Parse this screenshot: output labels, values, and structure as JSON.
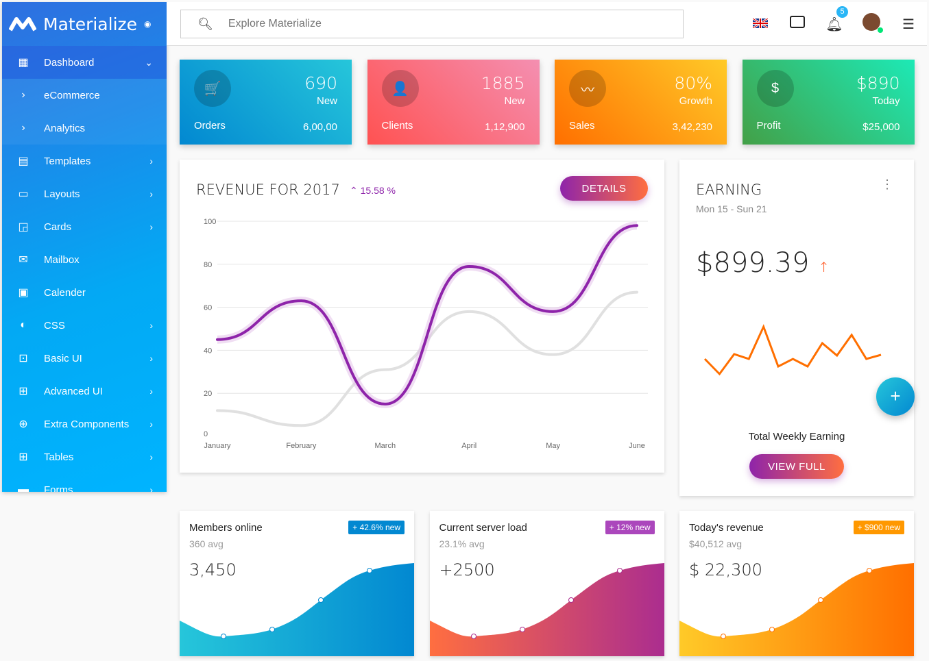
{
  "brand": {
    "name": "Materialize"
  },
  "sidebar": {
    "items": [
      {
        "label": "Dashboard",
        "icon": "dashboard-icon",
        "glyph": "▦",
        "chev": "⌄"
      },
      {
        "label": "eCommerce",
        "icon": "chevron-right-icon",
        "glyph": "›",
        "chev": ""
      },
      {
        "label": "Analytics",
        "icon": "chevron-right-icon",
        "glyph": "›",
        "chev": ""
      },
      {
        "label": "Templates",
        "icon": "templates-icon",
        "glyph": "▤",
        "chev": "›"
      },
      {
        "label": "Layouts",
        "icon": "layouts-icon",
        "glyph": "▭",
        "chev": "›"
      },
      {
        "label": "Cards",
        "icon": "cards-icon",
        "glyph": "◲",
        "chev": "›"
      },
      {
        "label": "Mailbox",
        "icon": "mail-icon",
        "glyph": "✉",
        "chev": ""
      },
      {
        "label": "Calender",
        "icon": "calendar-icon",
        "glyph": "▣",
        "chev": ""
      },
      {
        "label": "CSS",
        "icon": "drop-icon",
        "glyph": "◐",
        "chev": "›"
      },
      {
        "label": "Basic UI",
        "icon": "basic-ui-icon",
        "glyph": "⊡",
        "chev": "›"
      },
      {
        "label": "Advanced UI",
        "icon": "advanced-ui-icon",
        "glyph": "⊞",
        "chev": "›"
      },
      {
        "label": "Extra Components",
        "icon": "extra-icon",
        "glyph": "⊕",
        "chev": "›"
      },
      {
        "label": "Tables",
        "icon": "tables-icon",
        "glyph": "⊞",
        "chev": "›"
      },
      {
        "label": "Forms",
        "icon": "forms-icon",
        "glyph": "▬",
        "chev": "›"
      }
    ]
  },
  "header": {
    "search_placeholder": "Explore Materialize",
    "notification_count": "5"
  },
  "stats": [
    {
      "big": "690",
      "small": "New",
      "label": "Orders",
      "value": "6,00,00",
      "icon": "cart-icon",
      "glyph": "🛒",
      "gradient": [
        "#0288d1",
        "#26c6da"
      ]
    },
    {
      "big": "1885",
      "small": "New",
      "label": "Clients",
      "value": "1,12,900",
      "icon": "user-icon",
      "glyph": "👤",
      "gradient": [
        "#ff5252",
        "#f48fb1"
      ]
    },
    {
      "big": "80%",
      "small": "Growth",
      "label": "Sales",
      "value": "3,42,230",
      "icon": "trending-icon",
      "glyph": "〰",
      "gradient": [
        "#ff6f00",
        "#ffca28"
      ]
    },
    {
      "big": "$890",
      "small": "Today",
      "label": "Profit",
      "value": "$25,000",
      "icon": "dollar-icon",
      "glyph": "$",
      "gradient": [
        "#43a047",
        "#1de9b6"
      ]
    }
  ],
  "revenue": {
    "title": "REVENUE FOR 2017",
    "change": "15.58 %",
    "details": "DETAILS"
  },
  "chart_data": {
    "type": "line",
    "categories": [
      "January",
      "February",
      "March",
      "April",
      "May",
      "June"
    ],
    "ylim": [
      0,
      100
    ],
    "yticks": [
      0,
      20,
      40,
      60,
      80,
      100
    ],
    "grid": true,
    "series": [
      {
        "values": [
          45,
          63,
          15,
          79,
          58,
          98
        ],
        "color": "#8e24aa"
      },
      {
        "values": [
          12,
          5,
          31,
          58,
          38,
          67
        ],
        "color": "#e0e0e0"
      }
    ]
  },
  "earning": {
    "title": "EARNING",
    "range": "Mon 15 - Sun 21",
    "amount": "$899.39",
    "caption": "Total Weekly Earning",
    "button": "VIEW FULL",
    "spark": [
      22,
      0,
      29,
      22,
      69,
      11,
      22,
      11,
      45,
      27,
      57,
      22,
      28
    ]
  },
  "mini": [
    {
      "title": "Members online",
      "avg": "360 avg",
      "value": "3,450",
      "badge": "+ 42.6% new",
      "badge_color": "#0288d1",
      "colors": [
        "#26c6da",
        "#0288d1"
      ]
    },
    {
      "title": "Current server load",
      "avg": "23.1% avg",
      "value": "+2500",
      "badge": "+ 12% new",
      "badge_color": "#ab47bc",
      "colors": [
        "#ff6e40",
        "#ab2d8f"
      ]
    },
    {
      "title": "Today's revenue",
      "avg": "$40,512 avg",
      "value": "$ 22,300",
      "badge": "+ $900 new",
      "badge_color": "#ff9800",
      "colors": [
        "#ffca28",
        "#ff6f00"
      ]
    }
  ]
}
